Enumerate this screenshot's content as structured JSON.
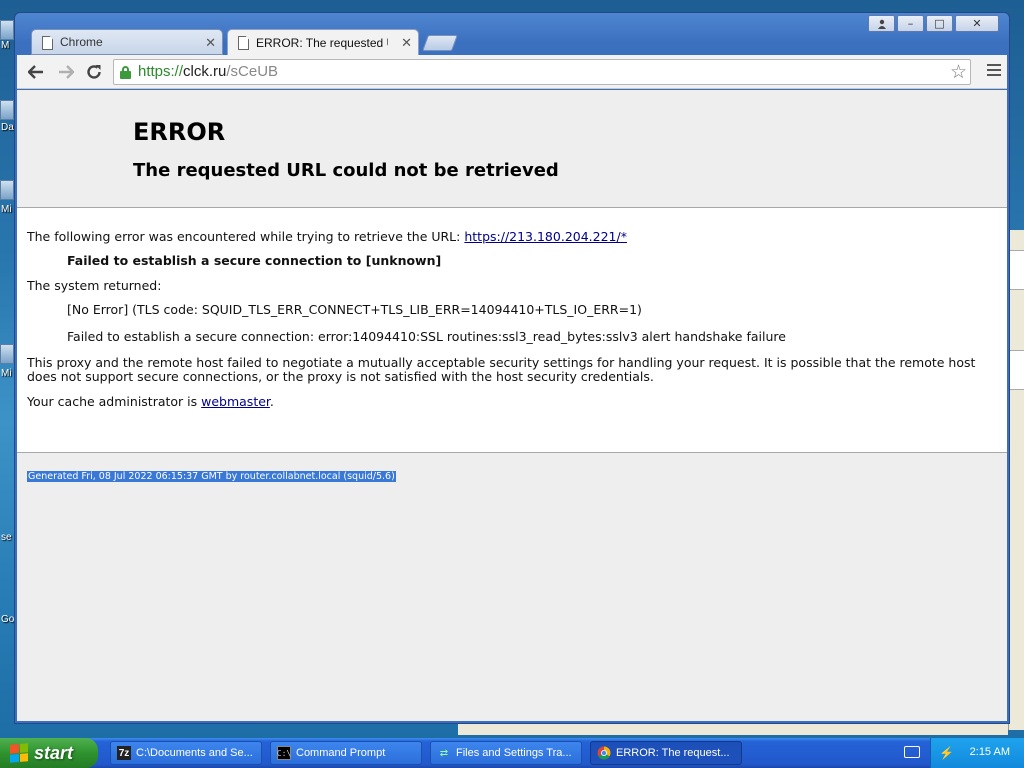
{
  "desktop": {
    "icon_labels": [
      "M",
      "Da",
      "Mi",
      "Mi",
      "se",
      "Go"
    ]
  },
  "browser": {
    "window_controls": {
      "user": "",
      "minimize": "–",
      "maximize": "□",
      "close": "✕"
    },
    "tabs": [
      {
        "title": "Chrome",
        "active": false,
        "close": "✕"
      },
      {
        "title": "ERROR: The requested URL",
        "active": true,
        "close": "✕"
      }
    ],
    "address": {
      "scheme": "https://",
      "host": "clck.ru",
      "path": "/sCeUB"
    }
  },
  "page": {
    "title": "ERROR",
    "subtitle": "The requested URL could not be retrieved",
    "intro_text": "The following error was encountered while trying to retrieve the URL: ",
    "intro_link": "https://213.180.204.221/*",
    "error_name": "Failed to establish a secure connection to [unknown]",
    "system_returned": "The system returned:",
    "system_detail_1": "[No Error] (TLS code: SQUID_TLS_ERR_CONNECT+TLS_LIB_ERR=14094410+TLS_IO_ERR=1)",
    "system_detail_2": "Failed to establish a secure connection: error:14094410:SSL routines:ssl3_read_bytes:sslv3 alert handshake failure",
    "explanation": "This proxy and the remote host failed to negotiate a mutually acceptable security settings for handling your request. It is possible that the remote host does not support secure connections, or the proxy is not satisfied with the host security credentials.",
    "admin_prefix": "Your cache administrator is ",
    "admin_link": "webmaster",
    "admin_suffix": ".",
    "footer": "Generated Fri, 08 Jul 2022 06:15:37 GMT by router.collabnet.local (squid/5.6)"
  },
  "taskbar": {
    "start_label": "start",
    "items": [
      {
        "label": "C:\\Documents and Se...",
        "icon": "7zip-icon"
      },
      {
        "label": "Command Prompt",
        "icon": "cmd-icon"
      },
      {
        "label": "Files and Settings Tra...",
        "icon": "transfer-wizard-icon"
      },
      {
        "label": "ERROR: The request...",
        "icon": "chrome-icon"
      }
    ],
    "clock": "2:15 AM"
  }
}
